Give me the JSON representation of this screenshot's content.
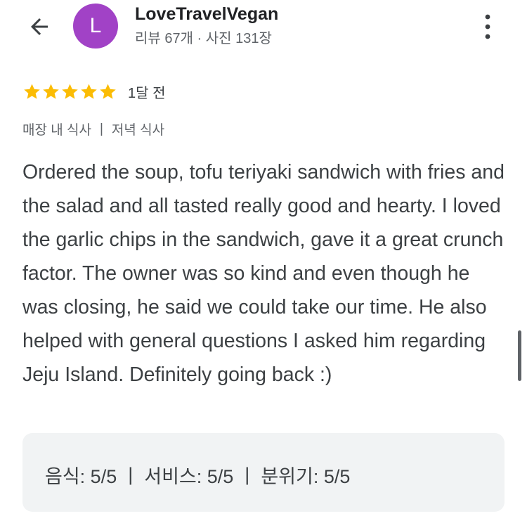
{
  "header": {
    "back_icon": "arrow-left-icon",
    "avatar_letter": "L",
    "avatar_color": "#a142c6",
    "author_name": "LoveTravelVegan",
    "author_meta": "리뷰 67개 · 사진 131장",
    "more_icon": "more-vertical-icon"
  },
  "review": {
    "rating": 5,
    "rating_max": 5,
    "star_color": "#fbbc04",
    "time": "1달 전",
    "tags": [
      "매장 내 식사",
      "저녁 식사"
    ],
    "tag_separator": "|",
    "text": "Ordered the soup, tofu teriyaki sandwich with fries and the salad and all tasted really good and hearty. I loved the garlic chips in the sandwich, gave it a great crunch factor. The owner was so kind and even though he was closing, he said we could take our time. He also helped with general questions I asked him regarding Jeju Island. Definitely going back :)"
  },
  "scores": {
    "separator": "|",
    "items": [
      {
        "label": "음식: 5/5"
      },
      {
        "label": "서비스: 5/5"
      },
      {
        "label": "분위기: 5/5"
      }
    ]
  }
}
